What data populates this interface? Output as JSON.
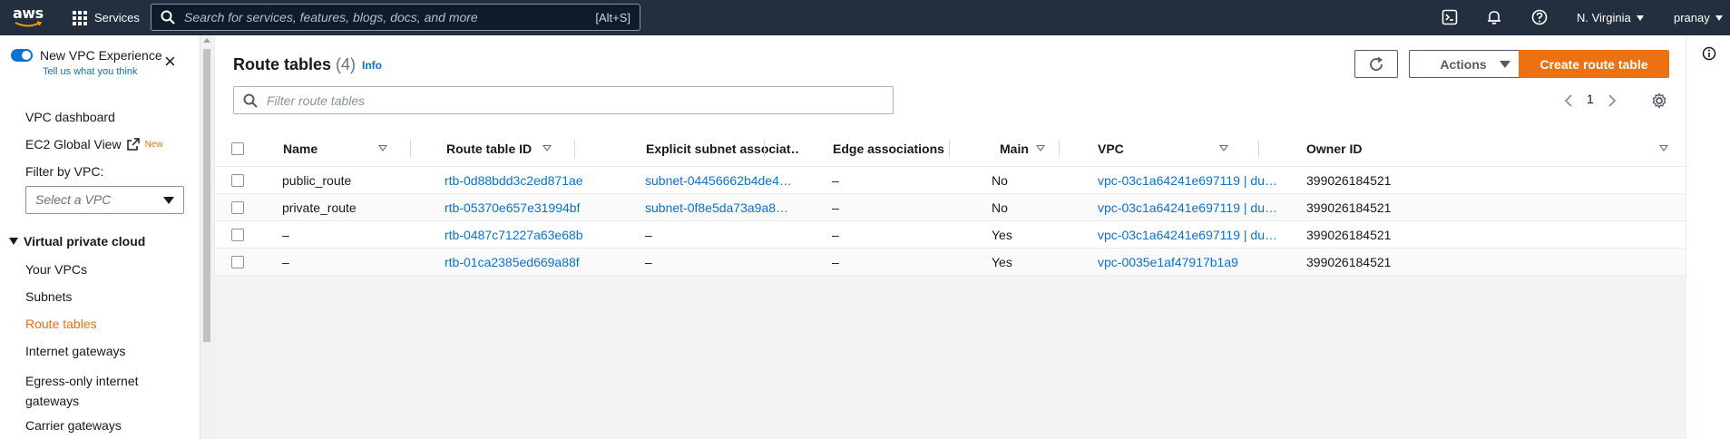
{
  "topnav": {
    "logo_text": "aws",
    "services_label": "Services",
    "search_placeholder": "Search for services, features, blogs, docs, and more",
    "search_shortcut": "[Alt+S]",
    "region": "N. Virginia",
    "user": "pranay"
  },
  "sidebar": {
    "new_experience_label": "New VPC Experience",
    "tell_us": "Tell us what you think",
    "dashboard": "VPC dashboard",
    "ec2_global_view": "EC2 Global View",
    "new_badge": "New",
    "filter_label": "Filter by VPC:",
    "select_placeholder": "Select a VPC",
    "section_title": "Virtual private cloud",
    "items": [
      "Your VPCs",
      "Subnets",
      "Route tables",
      "Internet gateways",
      "Egress-only internet gateways",
      "Carrier gateways"
    ],
    "active_item": "Route tables"
  },
  "main": {
    "title": "Route tables",
    "count": "(4)",
    "info": "Info",
    "actions_label": "Actions",
    "create_label": "Create route table",
    "filter_placeholder": "Filter route tables",
    "page_number": "1"
  },
  "table": {
    "columns": [
      "Name",
      "Route table ID",
      "Explicit subnet associat…",
      "Edge associations",
      "Main",
      "VPC",
      "Owner ID"
    ],
    "rows": [
      [
        "public_route",
        "rtb-0d88bdd3c2ed871ae",
        "subnet-04456662b4de4…",
        "–",
        "No",
        "vpc-03c1a64241e697119 | du…",
        "399026184521"
      ],
      [
        "private_route",
        "rtb-05370e657e31994bf",
        "subnet-0f8e5da73a9a8…",
        "–",
        "No",
        "vpc-03c1a64241e697119 | du…",
        "399026184521"
      ],
      [
        "–",
        "rtb-0487c71227a63e68b",
        "–",
        "–",
        "Yes",
        "vpc-03c1a64241e697119 | du…",
        "399026184521"
      ],
      [
        "–",
        "rtb-01ca2385ed669a88f",
        "–",
        "–",
        "Yes",
        "vpc-0035e1af47917b1a9",
        "399026184521"
      ]
    ]
  },
  "colors": {
    "nav_bg": "#232f3e",
    "accent_orange": "#ec7211",
    "link_blue": "#0972d3"
  }
}
